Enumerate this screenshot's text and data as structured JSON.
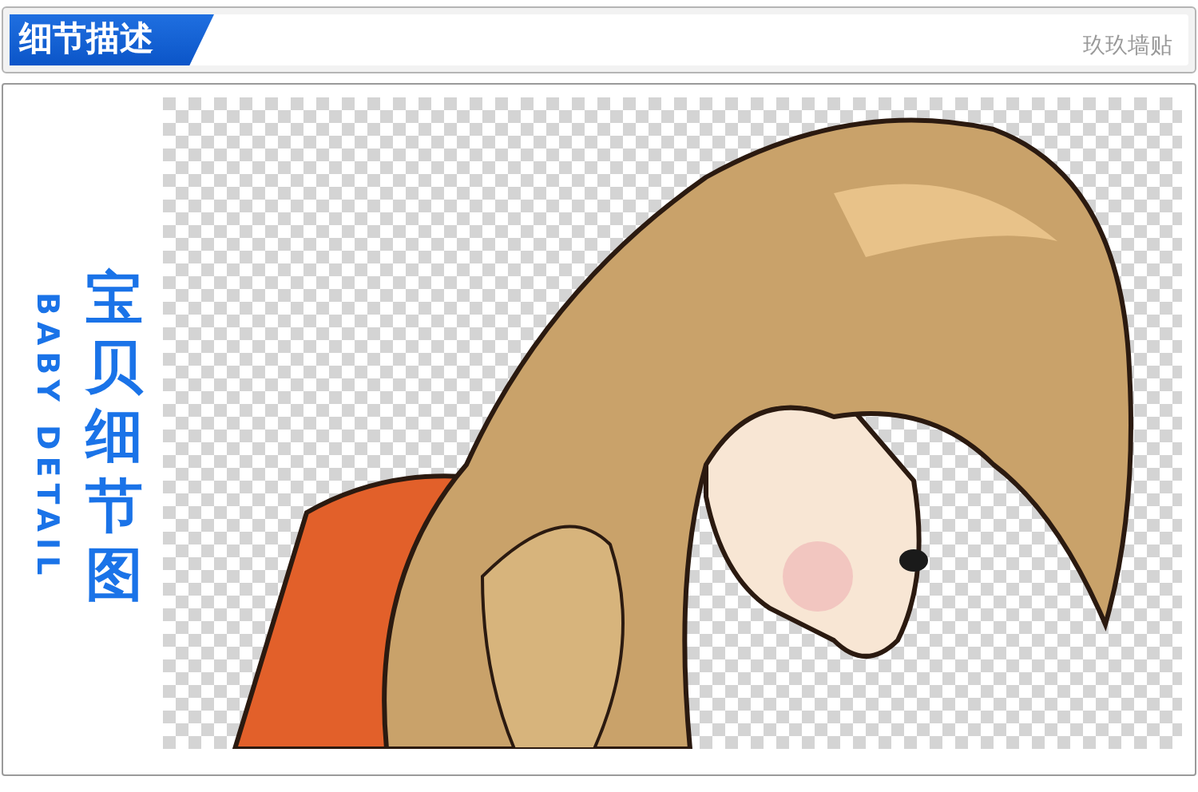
{
  "header": {
    "title": "细节描述",
    "brand": "玖玖墙贴"
  },
  "side": {
    "english": "BABY DETAIL",
    "chinese": "宝贝细节图"
  }
}
